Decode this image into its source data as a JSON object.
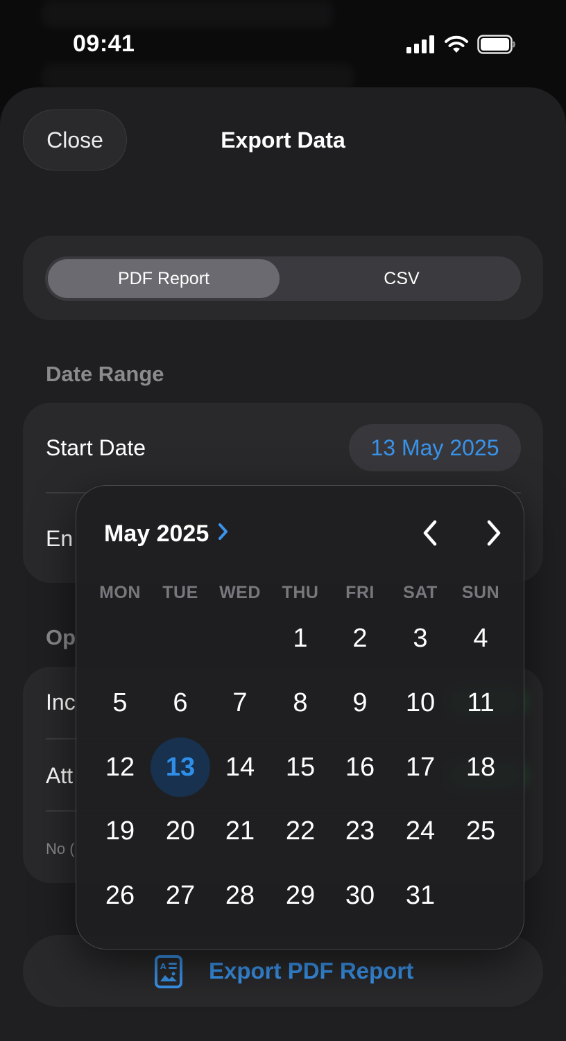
{
  "status_bar": {
    "time": "09:41"
  },
  "header": {
    "close_label": "Close",
    "title": "Export Data"
  },
  "format_picker": {
    "options": [
      "PDF Report",
      "CSV"
    ],
    "selected": "PDF Report"
  },
  "date_range": {
    "section_title": "Date Range",
    "start_label": "Start Date",
    "start_value": "13 May 2025",
    "end_label_visible": "En"
  },
  "options_section": {
    "title_visible": "Op",
    "row1_visible": "Inc",
    "row2_visible": "Att",
    "note_visible": "No ("
  },
  "calendar": {
    "month_label": "May 2025",
    "weekdays": [
      "MON",
      "TUE",
      "WED",
      "THU",
      "FRI",
      "SAT",
      "SUN"
    ],
    "first_weekday_index": 3,
    "days_in_month": 31,
    "selected_day": 13
  },
  "export_button": {
    "label": "Export PDF Report",
    "icon": "pdf-document-icon"
  },
  "colors": {
    "accent": "#3a93ea",
    "selected_day_bg": "#17314f",
    "toggle_on": "#30d158"
  }
}
